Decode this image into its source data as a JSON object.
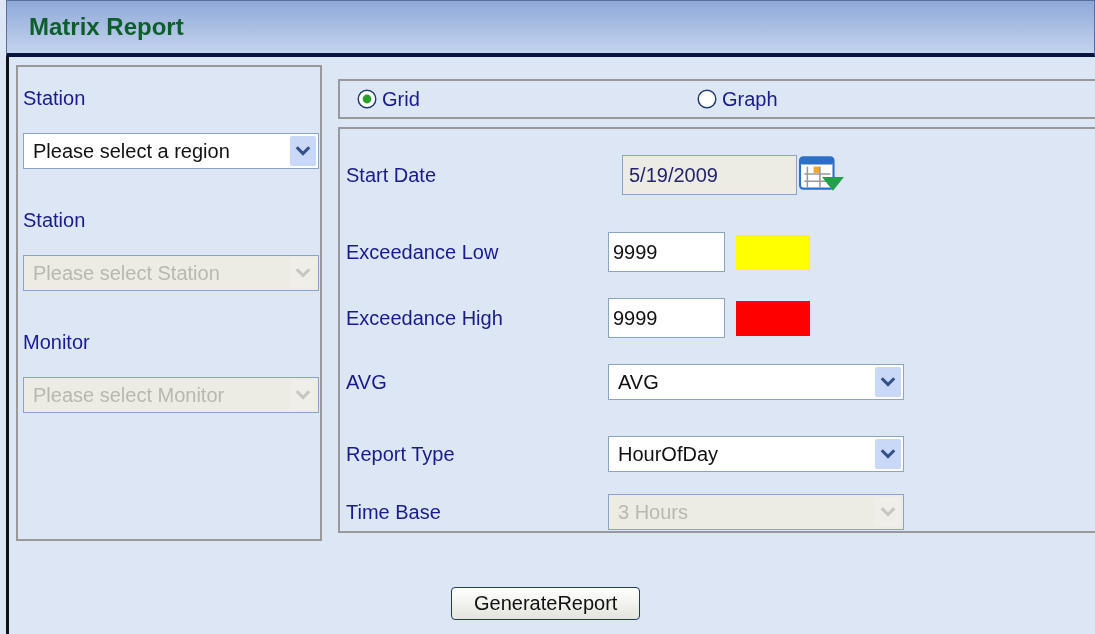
{
  "title": "Matrix Report",
  "left_panel": {
    "fields": [
      {
        "label": "Station",
        "value": "Please select a region",
        "disabled": false
      },
      {
        "label": "Station",
        "value": "Please select Station",
        "disabled": true
      },
      {
        "label": "Monitor",
        "value": "Please select Monitor",
        "disabled": true
      }
    ]
  },
  "view_options": [
    {
      "label": "Grid",
      "selected": true
    },
    {
      "label": "Graph",
      "selected": false
    }
  ],
  "form": [
    {
      "kind": "date",
      "label": "Start Date",
      "value": "5/19/2009"
    },
    {
      "kind": "threshold",
      "label": "Exceedance Low",
      "value": "9999",
      "color": "#ffff00"
    },
    {
      "kind": "threshold",
      "label": "Exceedance High",
      "value": "9999",
      "color": "#ff0000"
    },
    {
      "kind": "select",
      "label": "AVG",
      "value": "AVG",
      "disabled": false
    },
    {
      "kind": "select",
      "label": "Report Type",
      "value": "HourOfDay",
      "disabled": false
    },
    {
      "kind": "select",
      "label": "Time Base",
      "value": "3 Hours",
      "disabled": true
    }
  ],
  "button": "GenerateReport"
}
